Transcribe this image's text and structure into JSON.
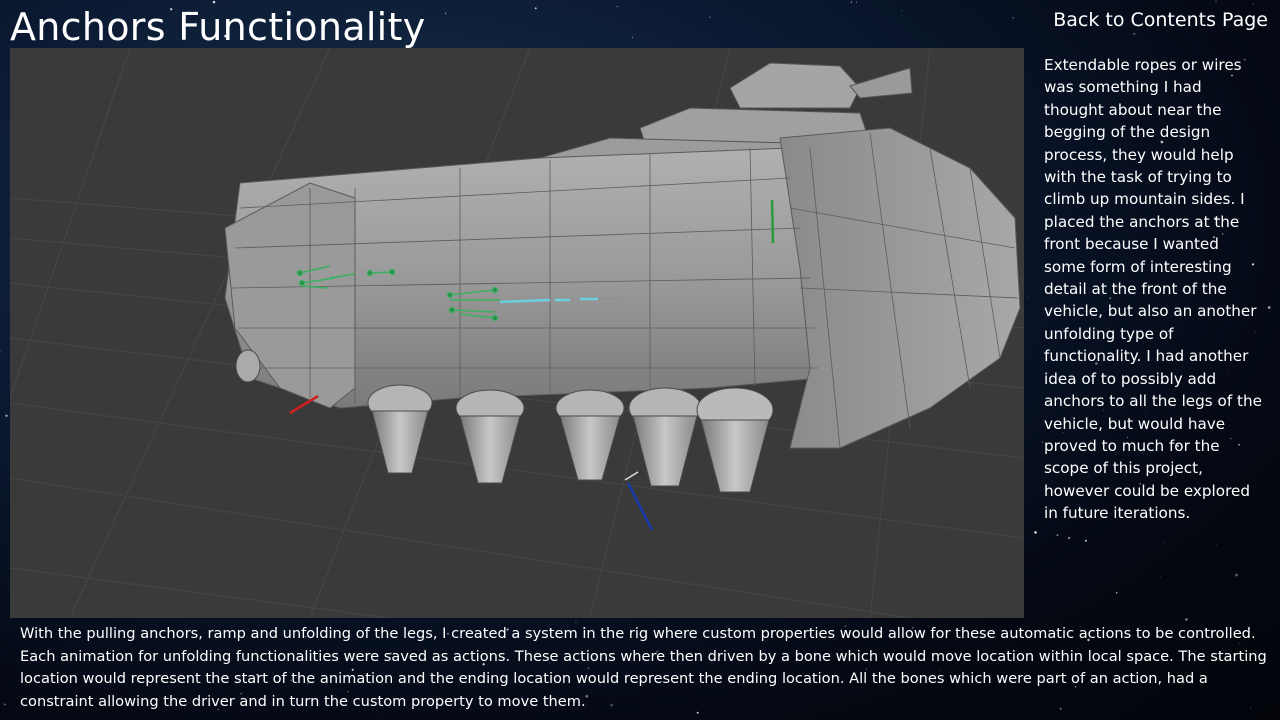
{
  "slide": {
    "title": "Anchors Functionality",
    "back_link_label": "Back to Contents Page"
  },
  "side_text": "Extendable ropes or wires was something I had thought about near the begging of the design process, they would help with the task of trying to climb up mountain sides. I placed the anchors at the front because I wanted some form of interesting detail at the front of the vehicle, but also an another unfolding type of functionality. I had another idea of to possibly add anchors to all the legs of the vehicle, but would have proved to much for the scope of this project, however could be explored in future iterations.",
  "bottom_text": "With the pulling anchors, ramp and unfolding of the legs, I created a system in the rig where custom properties would allow for these automatic actions to be controlled. Each animation for unfolding functionalities were saved as actions. These actions where then driven by a bone which would move location within local space. The starting location would represent the start of the animation and the ending location would represent the ending location. All the bones which were part of an action, had a constraint allowing the driver and in turn the custom property to move them.",
  "colors": {
    "viewport_bg": "#3a3a3a",
    "mesh_fill": "#9a9a9a",
    "bone_red": "#d02020",
    "bone_green": "#2a9a3a",
    "bone_blue": "#1a3aaa",
    "bone_cyan": "#6ad0e0"
  },
  "icons": {
    "viewport_content": "3d-vehicle-model-render"
  }
}
